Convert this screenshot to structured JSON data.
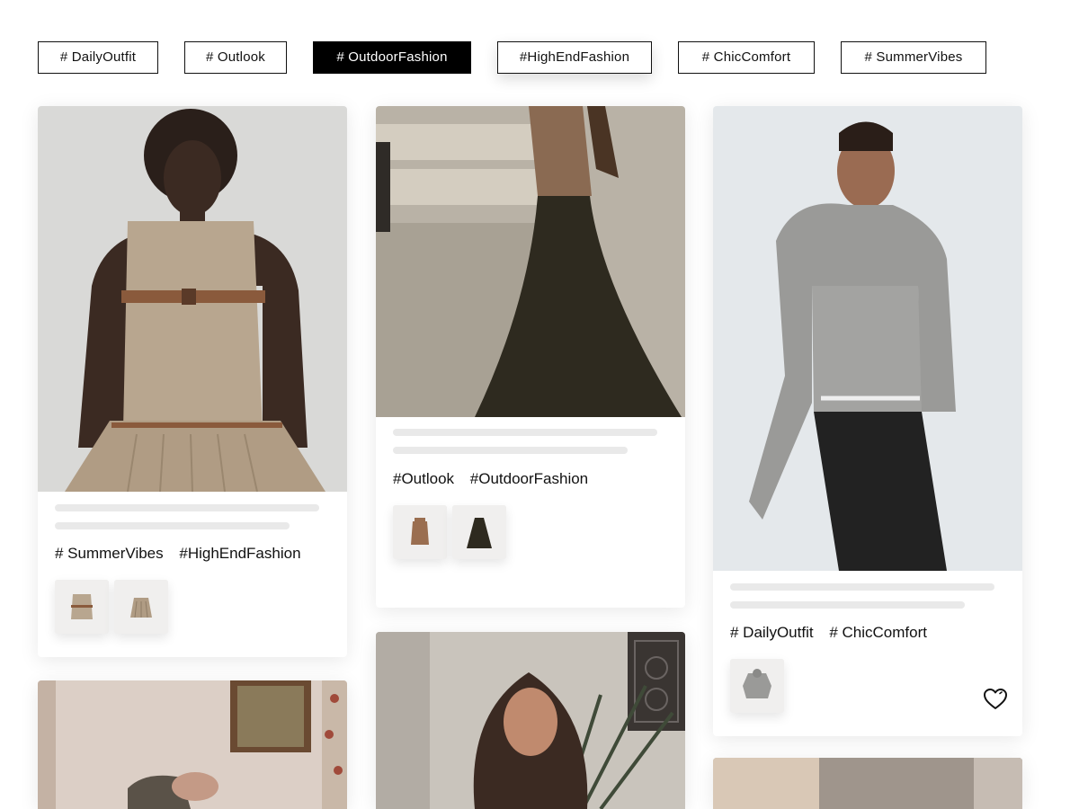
{
  "filter_tags": [
    {
      "label": "# DailyOutfit",
      "active": false
    },
    {
      "label": "# Outlook",
      "active": false
    },
    {
      "label": "# OutdoorFashion",
      "active": true
    },
    {
      "label": "#HighEndFashion",
      "active": false
    },
    {
      "label": "# ChicComfort",
      "active": false
    },
    {
      "label": "# SummerVibes",
      "active": false
    }
  ],
  "posts": [
    {
      "hashtags": [
        "# SummerVibes",
        "#HighEndFashion"
      ],
      "products": [
        "tan-corset-top",
        "tan-pleated-skirt"
      ]
    },
    {
      "hashtags": [
        "#Outlook",
        "#OutdoorFashion"
      ],
      "products": [
        "knit-vest",
        "dark-maxi-skirt"
      ]
    },
    {
      "hashtags": [
        "# DailyOutfit",
        "# ChicComfort"
      ],
      "products": [
        "grey-knit-hoodie"
      ],
      "icon": "heart-icon"
    },
    {
      "hashtags": [],
      "products": []
    },
    {
      "hashtags": [],
      "products": []
    },
    {
      "hashtags": [],
      "products": []
    }
  ],
  "colors": {
    "active_tag_bg": "#000000",
    "placeholder_bar": "#e9e9e9",
    "card_bg": "#ffffff"
  }
}
